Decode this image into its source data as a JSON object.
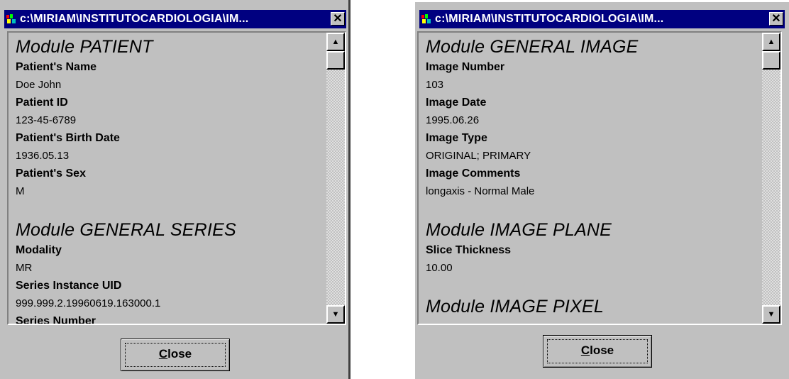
{
  "windows": [
    {
      "title": "c:\\MIRIAM\\INSTITUTOCARDIOLOGIA\\IM...",
      "close_glyph": "✕",
      "sections": [
        {
          "module": "Module PATIENT",
          "fields": [
            {
              "label": "Patient's Name",
              "value": "Doe John"
            },
            {
              "label": "Patient ID",
              "value": "123-45-6789"
            },
            {
              "label": "Patient's Birth Date",
              "value": "1936.05.13"
            },
            {
              "label": "Patient's Sex",
              "value": "M"
            }
          ]
        },
        {
          "module": "Module GENERAL SERIES",
          "fields": [
            {
              "label": "Modality",
              "value": "MR"
            },
            {
              "label": "Series Instance UID",
              "value": "999.999.2.19960619.163000.1"
            },
            {
              "label": "Series Number",
              "value": ""
            }
          ]
        }
      ],
      "button_label": "Close"
    },
    {
      "title": "c:\\MIRIAM\\INSTITUTOCARDIOLOGIA\\IM...",
      "close_glyph": "✕",
      "sections": [
        {
          "module": "Module GENERAL IMAGE",
          "fields": [
            {
              "label": "Image Number",
              "value": "103"
            },
            {
              "label": "Image Date",
              "value": "1995.06.26"
            },
            {
              "label": "Image Type",
              "value": "ORIGINAL; PRIMARY"
            },
            {
              "label": "Image Comments",
              "value": "longaxis - Normal Male"
            }
          ]
        },
        {
          "module": "Module IMAGE PLANE",
          "fields": [
            {
              "label": "Slice Thickness",
              "value": "10.00"
            }
          ]
        },
        {
          "module": "Module IMAGE PIXEL",
          "fields": []
        }
      ],
      "button_label": "Close"
    }
  ]
}
